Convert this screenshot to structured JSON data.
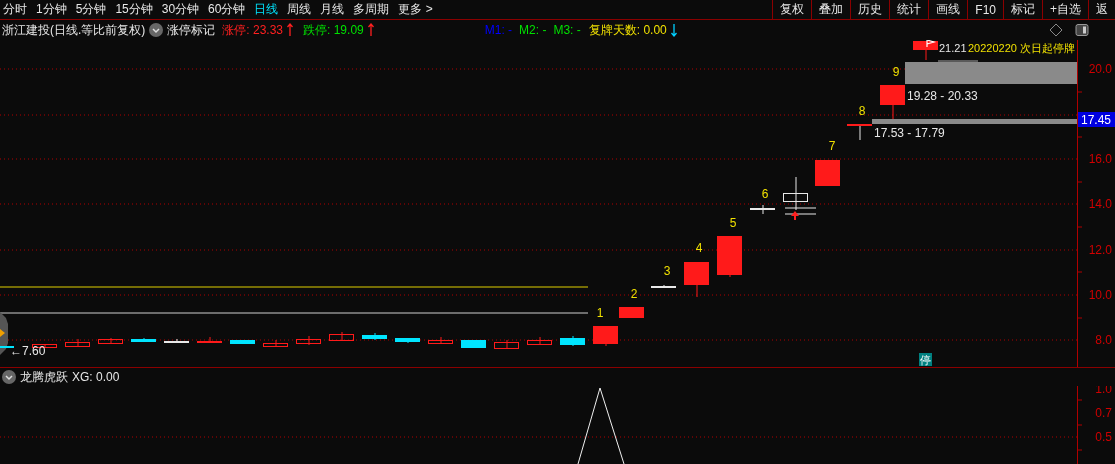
{
  "period_tabs": [
    {
      "label": "分时",
      "selected": false
    },
    {
      "label": "1分钟",
      "selected": false
    },
    {
      "label": "5分钟",
      "selected": false
    },
    {
      "label": "15分钟",
      "selected": false
    },
    {
      "label": "30分钟",
      "selected": false
    },
    {
      "label": "60分钟",
      "selected": false
    },
    {
      "label": "日线",
      "selected": true
    },
    {
      "label": "周线",
      "selected": false
    },
    {
      "label": "月线",
      "selected": false
    },
    {
      "label": "多周期",
      "selected": false
    },
    {
      "label": "更多 >",
      "selected": false
    }
  ],
  "tool_buttons": [
    "复权",
    "叠加",
    "历史",
    "统计",
    "画线",
    "F10",
    "标记",
    "+自选",
    "返"
  ],
  "info_bar": {
    "title": "浙江建投(日线.等比前复权)",
    "indicator": "涨停标记",
    "limit_up": "涨停: 23.33",
    "limit_down": "跌停: 19.09",
    "m_values": [
      {
        "label": "M1: -",
        "color": "#0000ff"
      },
      {
        "label": "M2: -",
        "color": "#00e000"
      },
      {
        "label": "M3: -",
        "color": "#00e000"
      }
    ],
    "resume_days": "复牌天数: 0.00"
  },
  "price_chart": {
    "y_axis_labels": [
      "20.0",
      "16.0",
      "14.0",
      "12.0",
      "10.0",
      "8.0"
    ],
    "price_tag": "17.45",
    "candle_numbers": [
      "1",
      "2",
      "3",
      "4",
      "5",
      "6",
      "7",
      "8",
      "9"
    ],
    "ranges": [
      "19.28 - 20.33",
      "17.53 - 17.79"
    ],
    "top_price": "21.21",
    "halt_note": "20220220 次日起停牌",
    "low_marker": "←7.60",
    "halt_badge": "停"
  },
  "indicator_pane": {
    "name": "龙腾虎跃",
    "reading": "XG: 0.00",
    "y_axis_labels": [
      "1.0",
      "0.7",
      "0.5"
    ]
  }
}
